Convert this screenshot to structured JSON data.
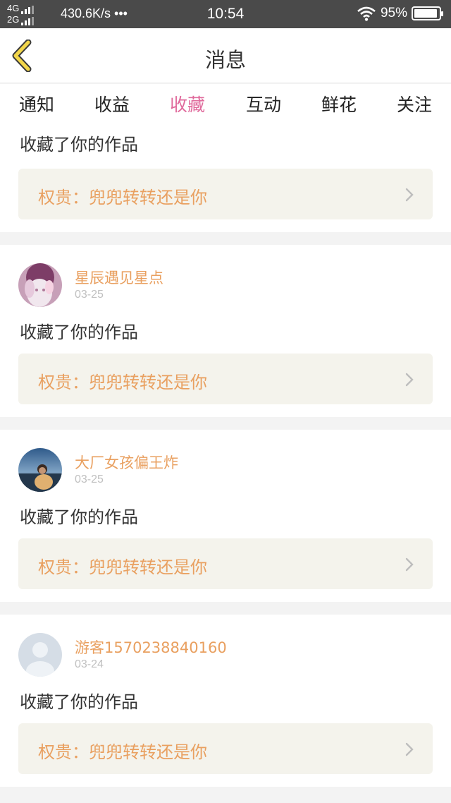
{
  "status_bar": {
    "net_top": "4G",
    "net_bottom": "2G",
    "speed": "430.6K/s •••",
    "time": "10:54",
    "battery": "95%",
    "battery_level": 0.95
  },
  "header": {
    "title": "消息",
    "back_icon": "chevron-left-icon"
  },
  "tabs": [
    {
      "label": "通知",
      "active": false
    },
    {
      "label": "收益",
      "active": false
    },
    {
      "label": "收藏",
      "active": true
    },
    {
      "label": "互动",
      "active": false
    },
    {
      "label": "鲜花",
      "active": false
    },
    {
      "label": "关注",
      "active": false
    }
  ],
  "feed": [
    {
      "user": "",
      "date": "",
      "action": "收藏了你的作品",
      "work": "权贵：兜兜转转还是你",
      "partial": true
    },
    {
      "user": "星辰遇见星点",
      "date": "03-25",
      "action": "收藏了你的作品",
      "work": "权贵：兜兜转转还是你",
      "avatar": "anime-girl-avatar"
    },
    {
      "user": "大厂女孩偏王炸",
      "date": "03-25",
      "action": "收藏了你的作品",
      "work": "权贵：兜兜转转还是你",
      "avatar": "photo-avatar"
    },
    {
      "user": "游客1570238840160",
      "date": "03-24",
      "action": "收藏了你的作品",
      "work": "权贵：兜兜转转还是你",
      "avatar": "default-user-avatar"
    }
  ],
  "colors": {
    "accent": "#e06a9c",
    "username": "#e9a060",
    "back_arrow": "#f2d64a"
  }
}
